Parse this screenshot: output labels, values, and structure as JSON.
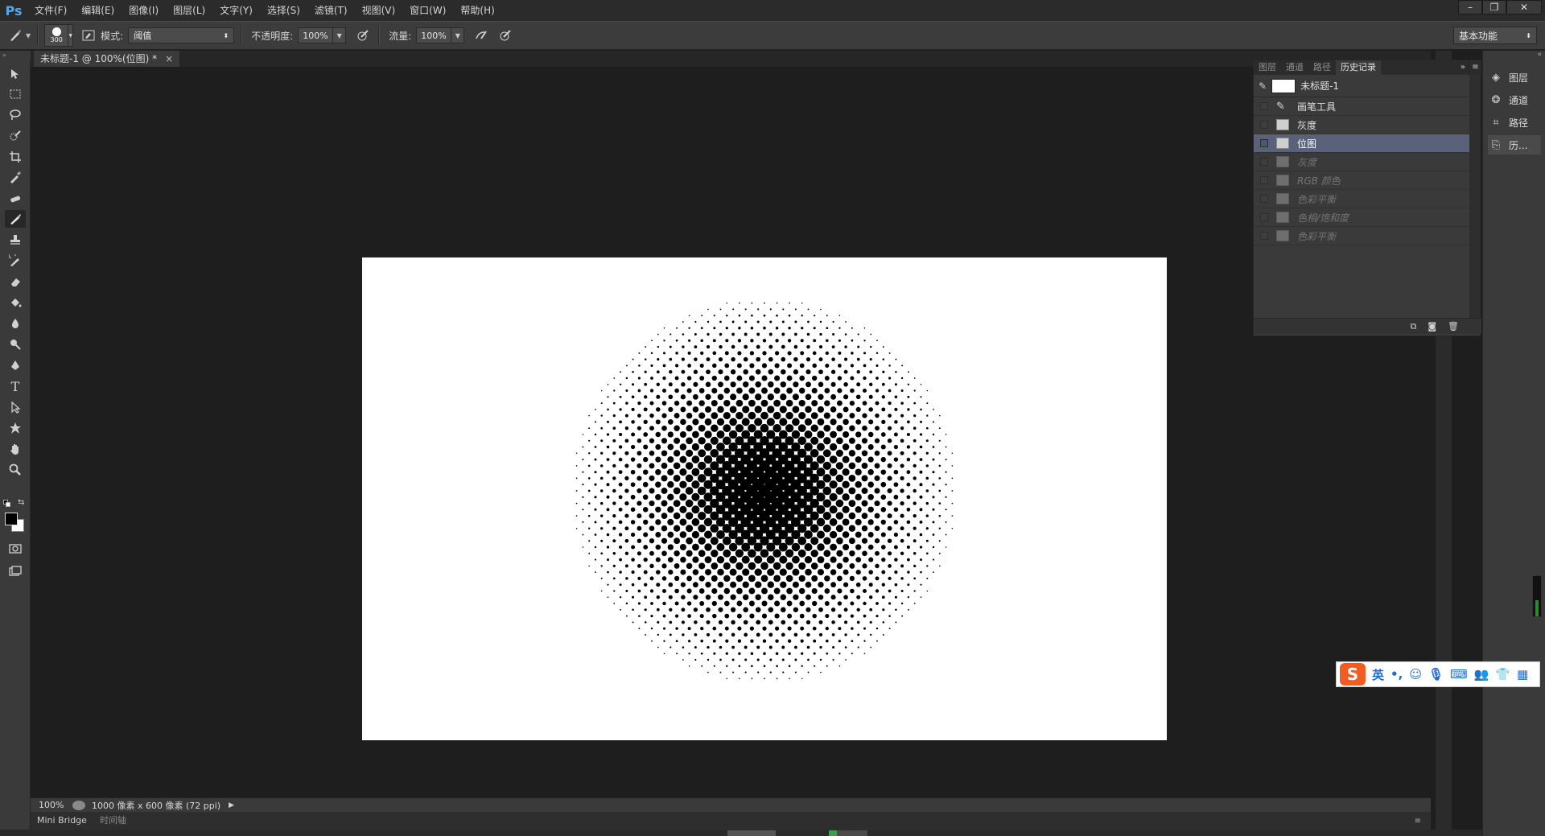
{
  "app": {
    "logo": "Ps"
  },
  "menu": [
    "文件(F)",
    "编辑(E)",
    "图像(I)",
    "图层(L)",
    "文字(Y)",
    "选择(S)",
    "滤镜(T)",
    "视图(V)",
    "窗口(W)",
    "帮助(H)"
  ],
  "window_controls": {
    "minimize": "–",
    "restore": "❐",
    "close": "✕"
  },
  "options_bar": {
    "brush_size": "300",
    "mode_label": "模式:",
    "mode_value": "阈值",
    "opacity_label": "不透明度:",
    "opacity_value": "100%",
    "flow_label": "流量:",
    "flow_value": "100%",
    "workspace": "基本功能"
  },
  "document_tab": {
    "title": "未标题-1 @ 100%(位图) *",
    "close": "×"
  },
  "status": {
    "zoom": "100%",
    "info": "1000 像素 x 600 像素 (72 ppi)"
  },
  "bottom_tabs": [
    "Mini Bridge",
    "时间轴"
  ],
  "panel": {
    "tabs": [
      "图层",
      "通道",
      "路径",
      "历史记录"
    ],
    "active_tab": "历史记录",
    "snapshot": "未标题-1",
    "history": [
      {
        "label": "画笔工具",
        "state": "done"
      },
      {
        "label": "灰度",
        "state": "done"
      },
      {
        "label": "位图",
        "state": "selected"
      },
      {
        "label": "灰度",
        "state": "future"
      },
      {
        "label": "RGB 颜色",
        "state": "future"
      },
      {
        "label": "色彩平衡",
        "state": "future"
      },
      {
        "label": "色相/饱和度",
        "state": "future"
      },
      {
        "label": "色彩平衡",
        "state": "future"
      }
    ]
  },
  "dock": [
    {
      "label": "图层",
      "icon": "layers-icon"
    },
    {
      "label": "通道",
      "icon": "channels-icon"
    },
    {
      "label": "路径",
      "icon": "paths-icon"
    },
    {
      "label": "历...",
      "icon": "history-icon"
    }
  ],
  "ime": {
    "logo": "S",
    "lang": "英"
  },
  "colors": {
    "selection": "#5a6279",
    "ime_logo": "#f25c20",
    "ps_blue": "#58a6e8"
  }
}
